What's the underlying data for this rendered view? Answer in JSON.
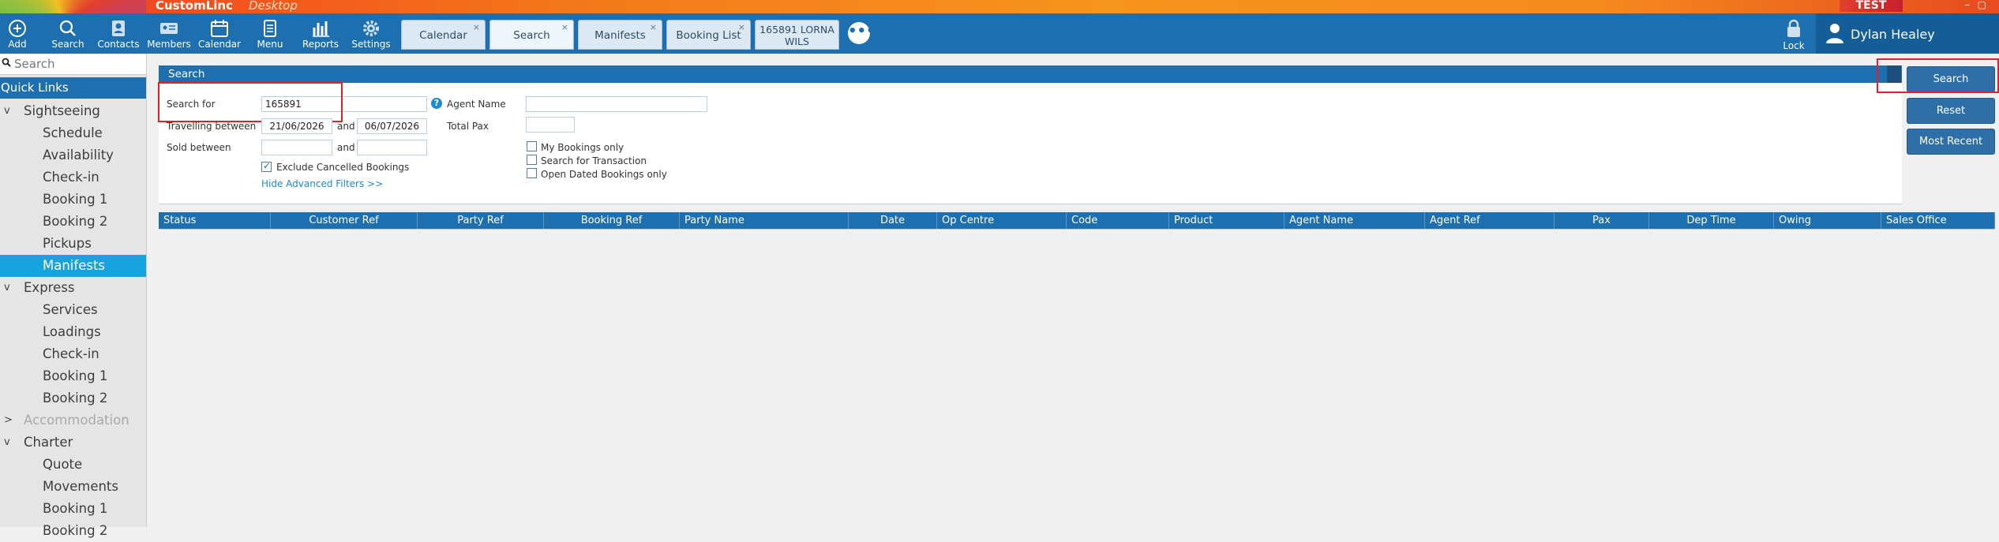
{
  "app": {
    "name": "CustomLinc",
    "subtitle": "Desktop",
    "environment": "TEST"
  },
  "toolbar": {
    "items": [
      {
        "label": "Add",
        "icon": "add-icon"
      },
      {
        "label": "Search",
        "icon": "search-icon"
      },
      {
        "label": "Contacts",
        "icon": "contacts-icon"
      },
      {
        "label": "Members",
        "icon": "members-icon"
      },
      {
        "label": "Calendar",
        "icon": "calendar-icon"
      },
      {
        "label": "Menu",
        "icon": "menu-icon"
      },
      {
        "label": "Reports",
        "icon": "reports-icon"
      },
      {
        "label": "Settings",
        "icon": "settings-icon"
      }
    ],
    "tabs": [
      {
        "label": "Calendar",
        "close": "×"
      },
      {
        "label": "Search",
        "close": "×"
      },
      {
        "label": "Manifests",
        "close": "×"
      },
      {
        "label": "Booking List",
        "close": "×"
      },
      {
        "label_line1": "165891 LORNA",
        "label_line2": "WILS"
      }
    ],
    "more_tabs": "•••",
    "lock_label": "Lock",
    "user_name": "Dylan Healey"
  },
  "sidebar": {
    "search_placeholder": "Search",
    "quick_links": "Quick Links",
    "items": [
      {
        "label": "Sightseeing",
        "type": "group",
        "chevron": "v"
      },
      {
        "label": "Schedule",
        "type": "sub"
      },
      {
        "label": "Availability",
        "type": "sub"
      },
      {
        "label": "Check-in",
        "type": "sub"
      },
      {
        "label": "Booking 1",
        "type": "sub"
      },
      {
        "label": "Booking 2",
        "type": "sub"
      },
      {
        "label": "Pickups",
        "type": "sub"
      },
      {
        "label": "Manifests",
        "type": "sub",
        "active": true
      },
      {
        "label": "Express",
        "type": "group",
        "chevron": "v"
      },
      {
        "label": "Services",
        "type": "sub"
      },
      {
        "label": "Loadings",
        "type": "sub"
      },
      {
        "label": "Check-in",
        "type": "sub"
      },
      {
        "label": "Booking 1",
        "type": "sub"
      },
      {
        "label": "Booking 2",
        "type": "sub"
      },
      {
        "label": "Accommodation",
        "type": "group",
        "chevron": ">",
        "disabled": true
      },
      {
        "label": "Charter",
        "type": "group",
        "chevron": "v"
      },
      {
        "label": "Quote",
        "type": "sub"
      },
      {
        "label": "Movements",
        "type": "sub"
      },
      {
        "label": "Booking 1",
        "type": "sub"
      },
      {
        "label": "Booking 2",
        "type": "sub"
      }
    ]
  },
  "search_panel": {
    "title": "Search",
    "search_for_label": "Search for",
    "search_for_value": "165891",
    "travelling_between_label": "Travelling between",
    "travel_from": "21/06/2026",
    "and_label": "and",
    "travel_to": "06/07/2026",
    "sold_between_label": "Sold between",
    "sold_from": "",
    "sold_to": "",
    "exclude_cancelled_label": "Exclude Cancelled Bookings",
    "exclude_cancelled_checked": true,
    "hide_advanced_link": "Hide Advanced Filters >>",
    "help_icon": "?",
    "agent_name_label": "Agent Name",
    "agent_name_value": "",
    "total_pax_label": "Total Pax",
    "total_pax_value": "",
    "my_bookings_label": "My Bookings only",
    "search_transaction_label": "Search for Transaction",
    "open_dated_label": "Open Dated Bookings only"
  },
  "actions": {
    "search": "Search",
    "reset": "Reset",
    "most_recent": "Most Recent"
  },
  "grid": {
    "columns": [
      "Status",
      "Customer Ref",
      "Party Ref",
      "Booking Ref",
      "Party Name",
      "Date",
      "Op Centre",
      "Code",
      "Product",
      "Agent Name",
      "Agent Ref",
      "Pax",
      "Dep Time",
      "Owing",
      "Sales Office"
    ],
    "rows": []
  },
  "colors": {
    "primary": "#1d6fb0",
    "active_item": "#16a3e0",
    "highlight": "#e0202a"
  }
}
